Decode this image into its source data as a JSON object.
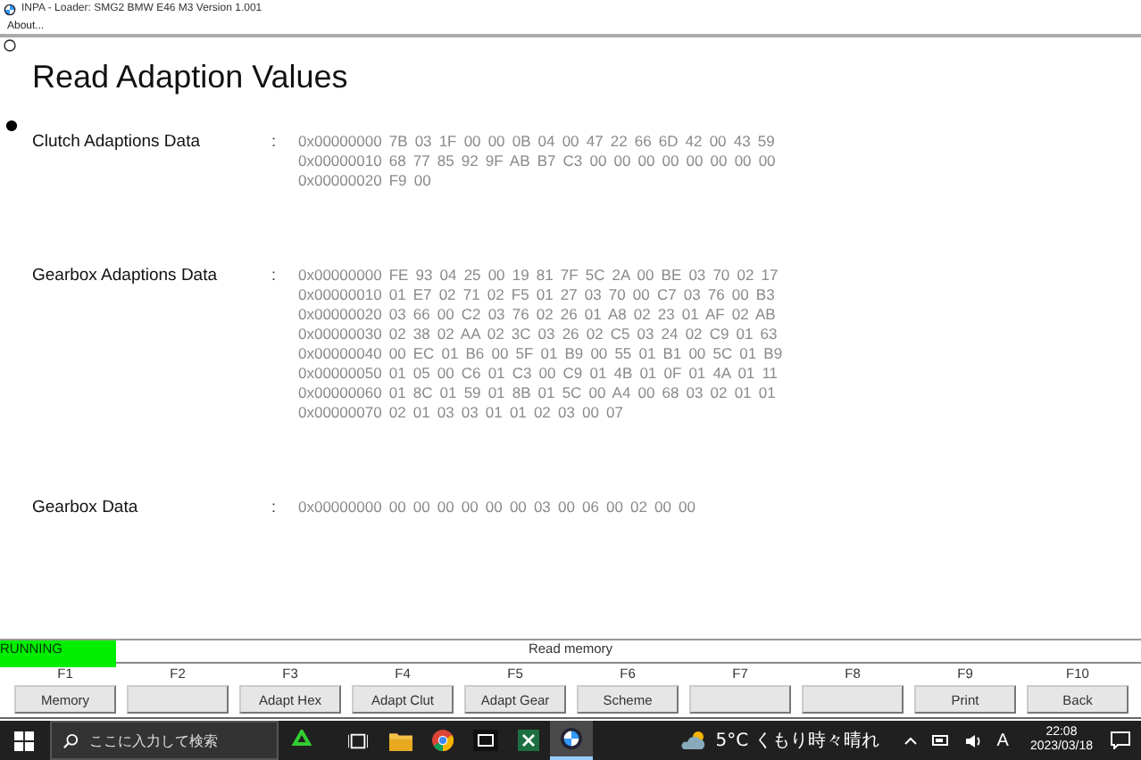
{
  "window": {
    "title": "INPA - Loader:  SMG2 BMW E46 M3 Version 1.001"
  },
  "menu": [
    "About..."
  ],
  "heading": "Read Adaption Values",
  "sections": [
    {
      "label": "Clutch Adaptions Data",
      "separator": ":",
      "lines": [
        "0x00000000 7B 03 1F 00 00 0B 04 00 47 22 66 6D 42 00 43 59",
        "0x00000010 68 77 85 92 9F AB B7 C3 00 00 00 00 00 00 00 00",
        "0x00000020 F9 00"
      ]
    },
    {
      "label": "Gearbox Adaptions Data",
      "separator": ":",
      "lines": [
        "0x00000000 FE 93 04 25 00 19 81 7F 5C 2A 00 BE 03 70 02 17",
        "0x00000010 01 E7 02 71 02 F5 01 27 03 70 00 C7 03 76 00 B3",
        "0x00000020 03 66 00 C2 03 76 02 26 01 A8 02 23 01 AF 02 AB",
        "0x00000030 02 38 02 AA 02 3C 03 26 02 C5 03 24 02 C9 01 63",
        "0x00000040 00 EC 01 B6 00 5F 01 B9 00 55 01 B1 00 5C 01 B9",
        "0x00000050 01 05 00 C6 01 C3 00 C9 01 4B 01 0F 01 4A 01 11",
        "0x00000060 01 8C 01 59 01 8B 01 5C 00 A4 00 68 03 02 01 01",
        "0x00000070 02 01 03 03 01 01 02 03 00 07"
      ]
    },
    {
      "label": "Gearbox Data",
      "separator": ":",
      "lines": [
        "0x00000000 00 00 00 00 00 00 03 00 06 00 02 00 00"
      ]
    }
  ],
  "status": {
    "state": "RUNNING",
    "message": "Read memory"
  },
  "fkeys": [
    {
      "key": "F1",
      "label": "Memory"
    },
    {
      "key": "F2"
    },
    {
      "key": "F3",
      "label": "Adapt Hex"
    },
    {
      "key": "F4",
      "label": "Adapt Clut"
    },
    {
      "key": "F5",
      "label": "Adapt Gear"
    },
    {
      "key": "F6",
      "label": "Scheme"
    },
    {
      "key": "F7"
    },
    {
      "key": "F8"
    },
    {
      "key": "F9",
      "label": "Print"
    },
    {
      "key": "F10",
      "label": "Back"
    }
  ],
  "taskbar": {
    "search_placeholder": "ここに入力して検索",
    "apps": [
      {
        "kind": "taskview",
        "selected": false
      },
      {
        "kind": "folder",
        "selected": false
      },
      {
        "kind": "browser",
        "selected": false
      },
      {
        "kind": "gif",
        "selected": false
      },
      {
        "kind": "excel",
        "selected": false
      },
      {
        "kind": "bmw",
        "selected": true
      }
    ],
    "weather": "5°C  くもり時々晴れ",
    "ime": "A",
    "time": "22:08",
    "date": "2023/03/18"
  }
}
